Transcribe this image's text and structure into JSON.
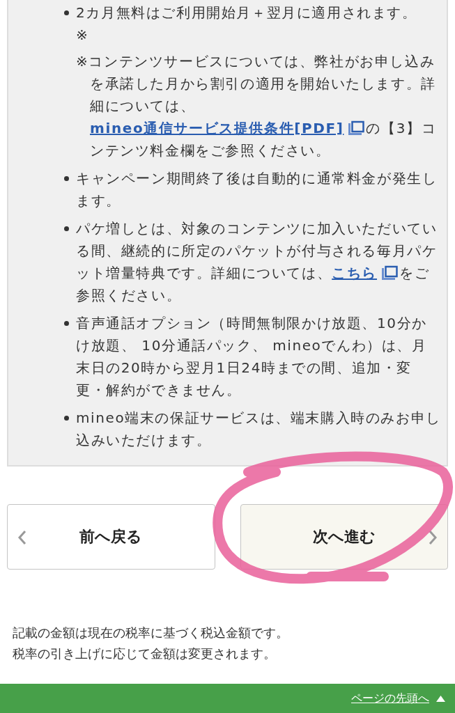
{
  "notes": [
    {
      "parts": [
        {
          "kind": "text",
          "text": "2カ月無料はご利用開始月＋翌月に適用されます。"
        }
      ],
      "mark": "※",
      "subnote": [
        {
          "kind": "text",
          "text": "※コンテンツサービスについては、弊社がお申し込みを承諾した月から割引の適用を開始いたします。詳細については、"
        },
        {
          "kind": "link",
          "text": "mineo通信サービス提供条件[PDF]"
        },
        {
          "kind": "external"
        },
        {
          "kind": "text",
          "text": "の【3】コンテンツ料金欄をご参照ください。"
        }
      ]
    },
    {
      "parts": [
        {
          "kind": "text",
          "text": "キャンペーン期間終了後は自動的に通常料金が発生します。"
        }
      ]
    },
    {
      "parts": [
        {
          "kind": "text",
          "text": "パケ増しとは、対象のコンテンツに加入いただいている間、継続的に所定のパケットが付与される毎月パケット増量特典です。詳細については、"
        },
        {
          "kind": "link",
          "text": "こちら"
        },
        {
          "kind": "external"
        },
        {
          "kind": "text",
          "text": "をご参照ください。"
        }
      ]
    },
    {
      "parts": [
        {
          "kind": "text",
          "text": "音声通話オプション（時間無制限かけ放題、10分かけ放題、 10分通話パック、 mineoでんわ）は、月末日の20時から翌月1日24時までの間、追加・変更・解約ができません。"
        }
      ]
    },
    {
      "parts": [
        {
          "kind": "text",
          "text": "mineo端末の保証サービスは、端末購入時のみお申し込みいただけます。"
        }
      ]
    }
  ],
  "nav": [
    {
      "label": "前へ戻る",
      "kind": "back",
      "highlighted": false
    },
    {
      "label": "次へ進む",
      "kind": "forward",
      "highlighted": true
    }
  ],
  "tax_notice": [
    "記載の金額は現在の税率に基づく税込金額です。",
    "税率の引き上げに応じて金額は変更されます。"
  ],
  "page_top": {
    "label": "ページの先頭へ"
  }
}
